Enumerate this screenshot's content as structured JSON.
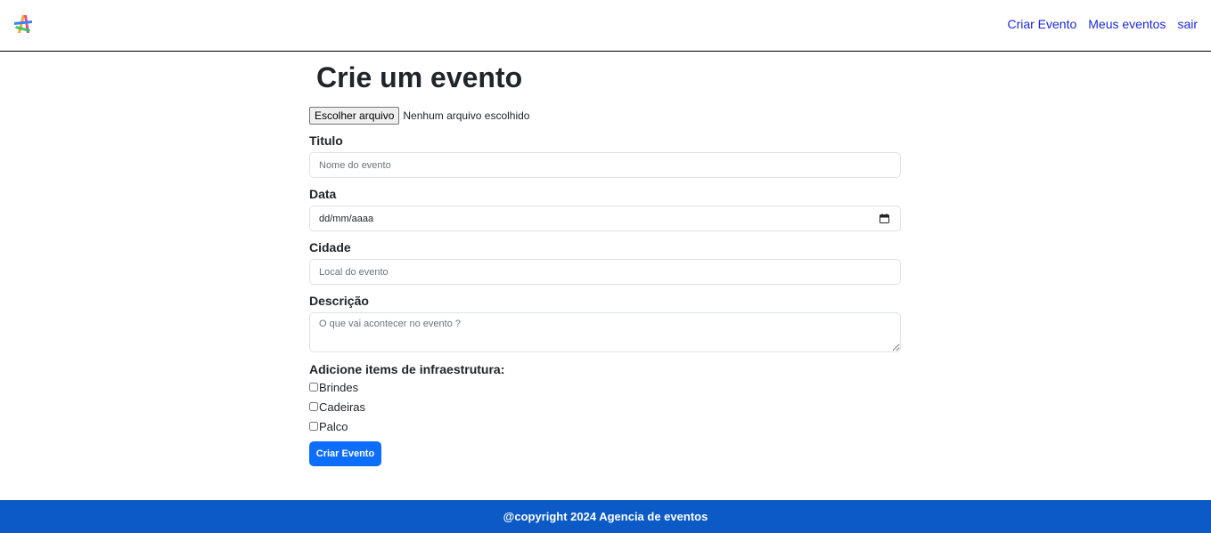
{
  "nav": {
    "logo_icon": "colorful-star-logo-icon",
    "links": [
      "Criar Evento",
      "Meus eventos",
      "sair"
    ]
  },
  "form": {
    "title": "Crie um evento",
    "file_button": "Escolher arquivo",
    "file_status": "Nenhum arquivo escolhido",
    "title_label": "Titulo",
    "title_placeholder": "Nome do evento",
    "date_label": "Data",
    "date_value": "dd/mm/aaaa",
    "city_label": "Cidade",
    "city_placeholder": "Local do evento",
    "description_label": "Descrição",
    "description_placeholder": "O que vai acontecer no evento ?",
    "infra_title": "Adicione items de infraestrutura:",
    "infra_items": [
      "Brindes",
      "Cadeiras",
      "Palco"
    ],
    "submit": "Criar Evento"
  },
  "footer": {
    "text": "@copyright 2024 Agencia de eventos"
  },
  "colors": {
    "nav_link": "#1a2bd6",
    "primary_button": "#0d6efd",
    "footer_bg": "#0b5ac6"
  }
}
